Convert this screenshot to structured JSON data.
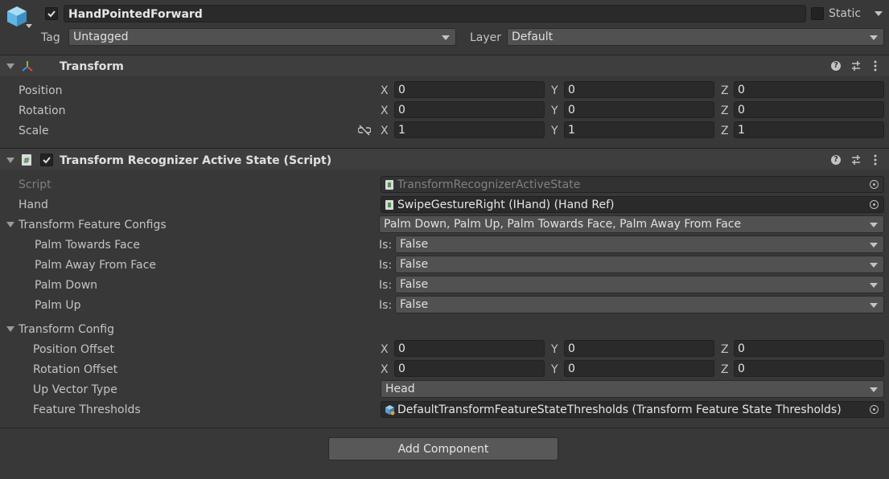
{
  "header": {
    "object_name": "HandPointedForward",
    "static_label": "Static",
    "tag_label": "Tag",
    "tag_value": "Untagged",
    "layer_label": "Layer",
    "layer_value": "Default"
  },
  "transform": {
    "title": "Transform",
    "rows": [
      {
        "label": "Position",
        "x": "0",
        "y": "0",
        "z": "0"
      },
      {
        "label": "Rotation",
        "x": "0",
        "y": "0",
        "z": "0"
      },
      {
        "label": "Scale",
        "x": "1",
        "y": "1",
        "z": "1"
      }
    ],
    "axis": {
      "x": "X",
      "y": "Y",
      "z": "Z"
    }
  },
  "script_component": {
    "title": "Transform Recognizer Active State (Script)",
    "script_label": "Script",
    "script_value": "TransformRecognizerActiveState",
    "hand_label": "Hand",
    "hand_value": "SwipeGestureRight (IHand) (Hand Ref)",
    "feature_configs_label": "Transform Feature Configs",
    "feature_configs_value": "Palm Down, Palm Up, Palm Towards Face, Palm Away From Face",
    "is_label": "Is:",
    "configs": [
      {
        "label": "Palm Towards Face",
        "value": "False"
      },
      {
        "label": "Palm Away From Face",
        "value": "False"
      },
      {
        "label": "Palm Down",
        "value": "False"
      },
      {
        "label": "Palm Up",
        "value": "False"
      }
    ],
    "transform_config_label": "Transform Config",
    "position_offset_label": "Position Offset",
    "position_offset": {
      "x": "0",
      "y": "0",
      "z": "0"
    },
    "rotation_offset_label": "Rotation Offset",
    "rotation_offset": {
      "x": "0",
      "y": "0",
      "z": "0"
    },
    "up_vector_label": "Up Vector Type",
    "up_vector_value": "Head",
    "thresholds_label": "Feature Thresholds",
    "thresholds_value": "DefaultTransformFeatureStateThresholds (Transform Feature State Thresholds)"
  },
  "add_component_label": "Add Component",
  "colors": {
    "background": "#383838",
    "field": "#2a2a2a",
    "dropdown": "#515151",
    "accent_cube": "#62b6e7"
  }
}
